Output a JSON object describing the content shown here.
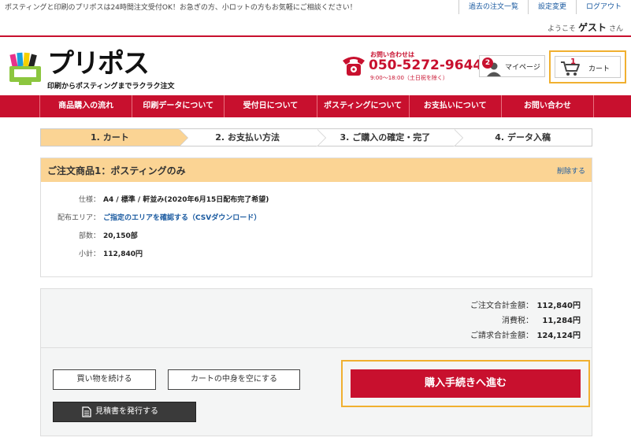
{
  "topbar": {
    "notice": "ポスティングと印刷のプリポスは24時間注文受付OK！お急ぎの方、小ロットの方もお気軽にご相談ください！",
    "links": [
      "過去の注文一覧",
      "設定変更",
      "ログアウト"
    ],
    "welcome_prefix": "ようこそ",
    "user_name": "ゲスト",
    "welcome_suffix": "さん"
  },
  "logo": {
    "name": "プリポス",
    "tagline": "印刷からポスティングまでラクラク注文"
  },
  "contact": {
    "label": "お問い合わせは",
    "phone": "050-5272-9644",
    "hours": "9:00〜18:00（土日祝を除く）"
  },
  "mypage": {
    "badge": "2",
    "label": "マイページ"
  },
  "cart": {
    "count": "1",
    "label": "カート"
  },
  "nav": [
    "商品購入の流れ",
    "印刷データについて",
    "受付日について",
    "ポスティングについて",
    "お支払いについて",
    "お問い合わせ"
  ],
  "steps": [
    {
      "label": "1. カート",
      "active": true
    },
    {
      "label": "2. お支払い方法",
      "active": false
    },
    {
      "label": "3. ご購入の確定・完了",
      "active": false
    },
    {
      "label": "4. データ入稿",
      "active": false
    }
  ],
  "order": {
    "title": "ご注文商品1：ポスティングのみ",
    "delete_label": "削除する",
    "details": [
      {
        "key": "仕様：",
        "value": "A4 / 標準 / 軒並み(2020年6月15日配布完了希望)",
        "link": false
      },
      {
        "key": "配布エリア：",
        "value": "ご指定のエリアを確認する（CSVダウンロード）",
        "link": true
      },
      {
        "key": "部数：",
        "value": "20,150部",
        "link": false
      },
      {
        "key": "小計：",
        "value": "112,840円",
        "link": false
      }
    ]
  },
  "totals": [
    {
      "key": "ご注文合計金額：",
      "value": "112,840円"
    },
    {
      "key": "消費税：",
      "value": "11,284円"
    },
    {
      "key": "ご請求合計金額：",
      "value": "124,124円"
    }
  ],
  "buttons": {
    "continue_shopping": "買い物を続ける",
    "empty_cart": "カートの中身を空にする",
    "issue_quote": "見積書を発行する",
    "checkout": "購入手続きへ進む"
  },
  "colors": {
    "brand_red": "#c8102e",
    "accent_orange": "#f0b030",
    "step_active": "#fbd494"
  }
}
